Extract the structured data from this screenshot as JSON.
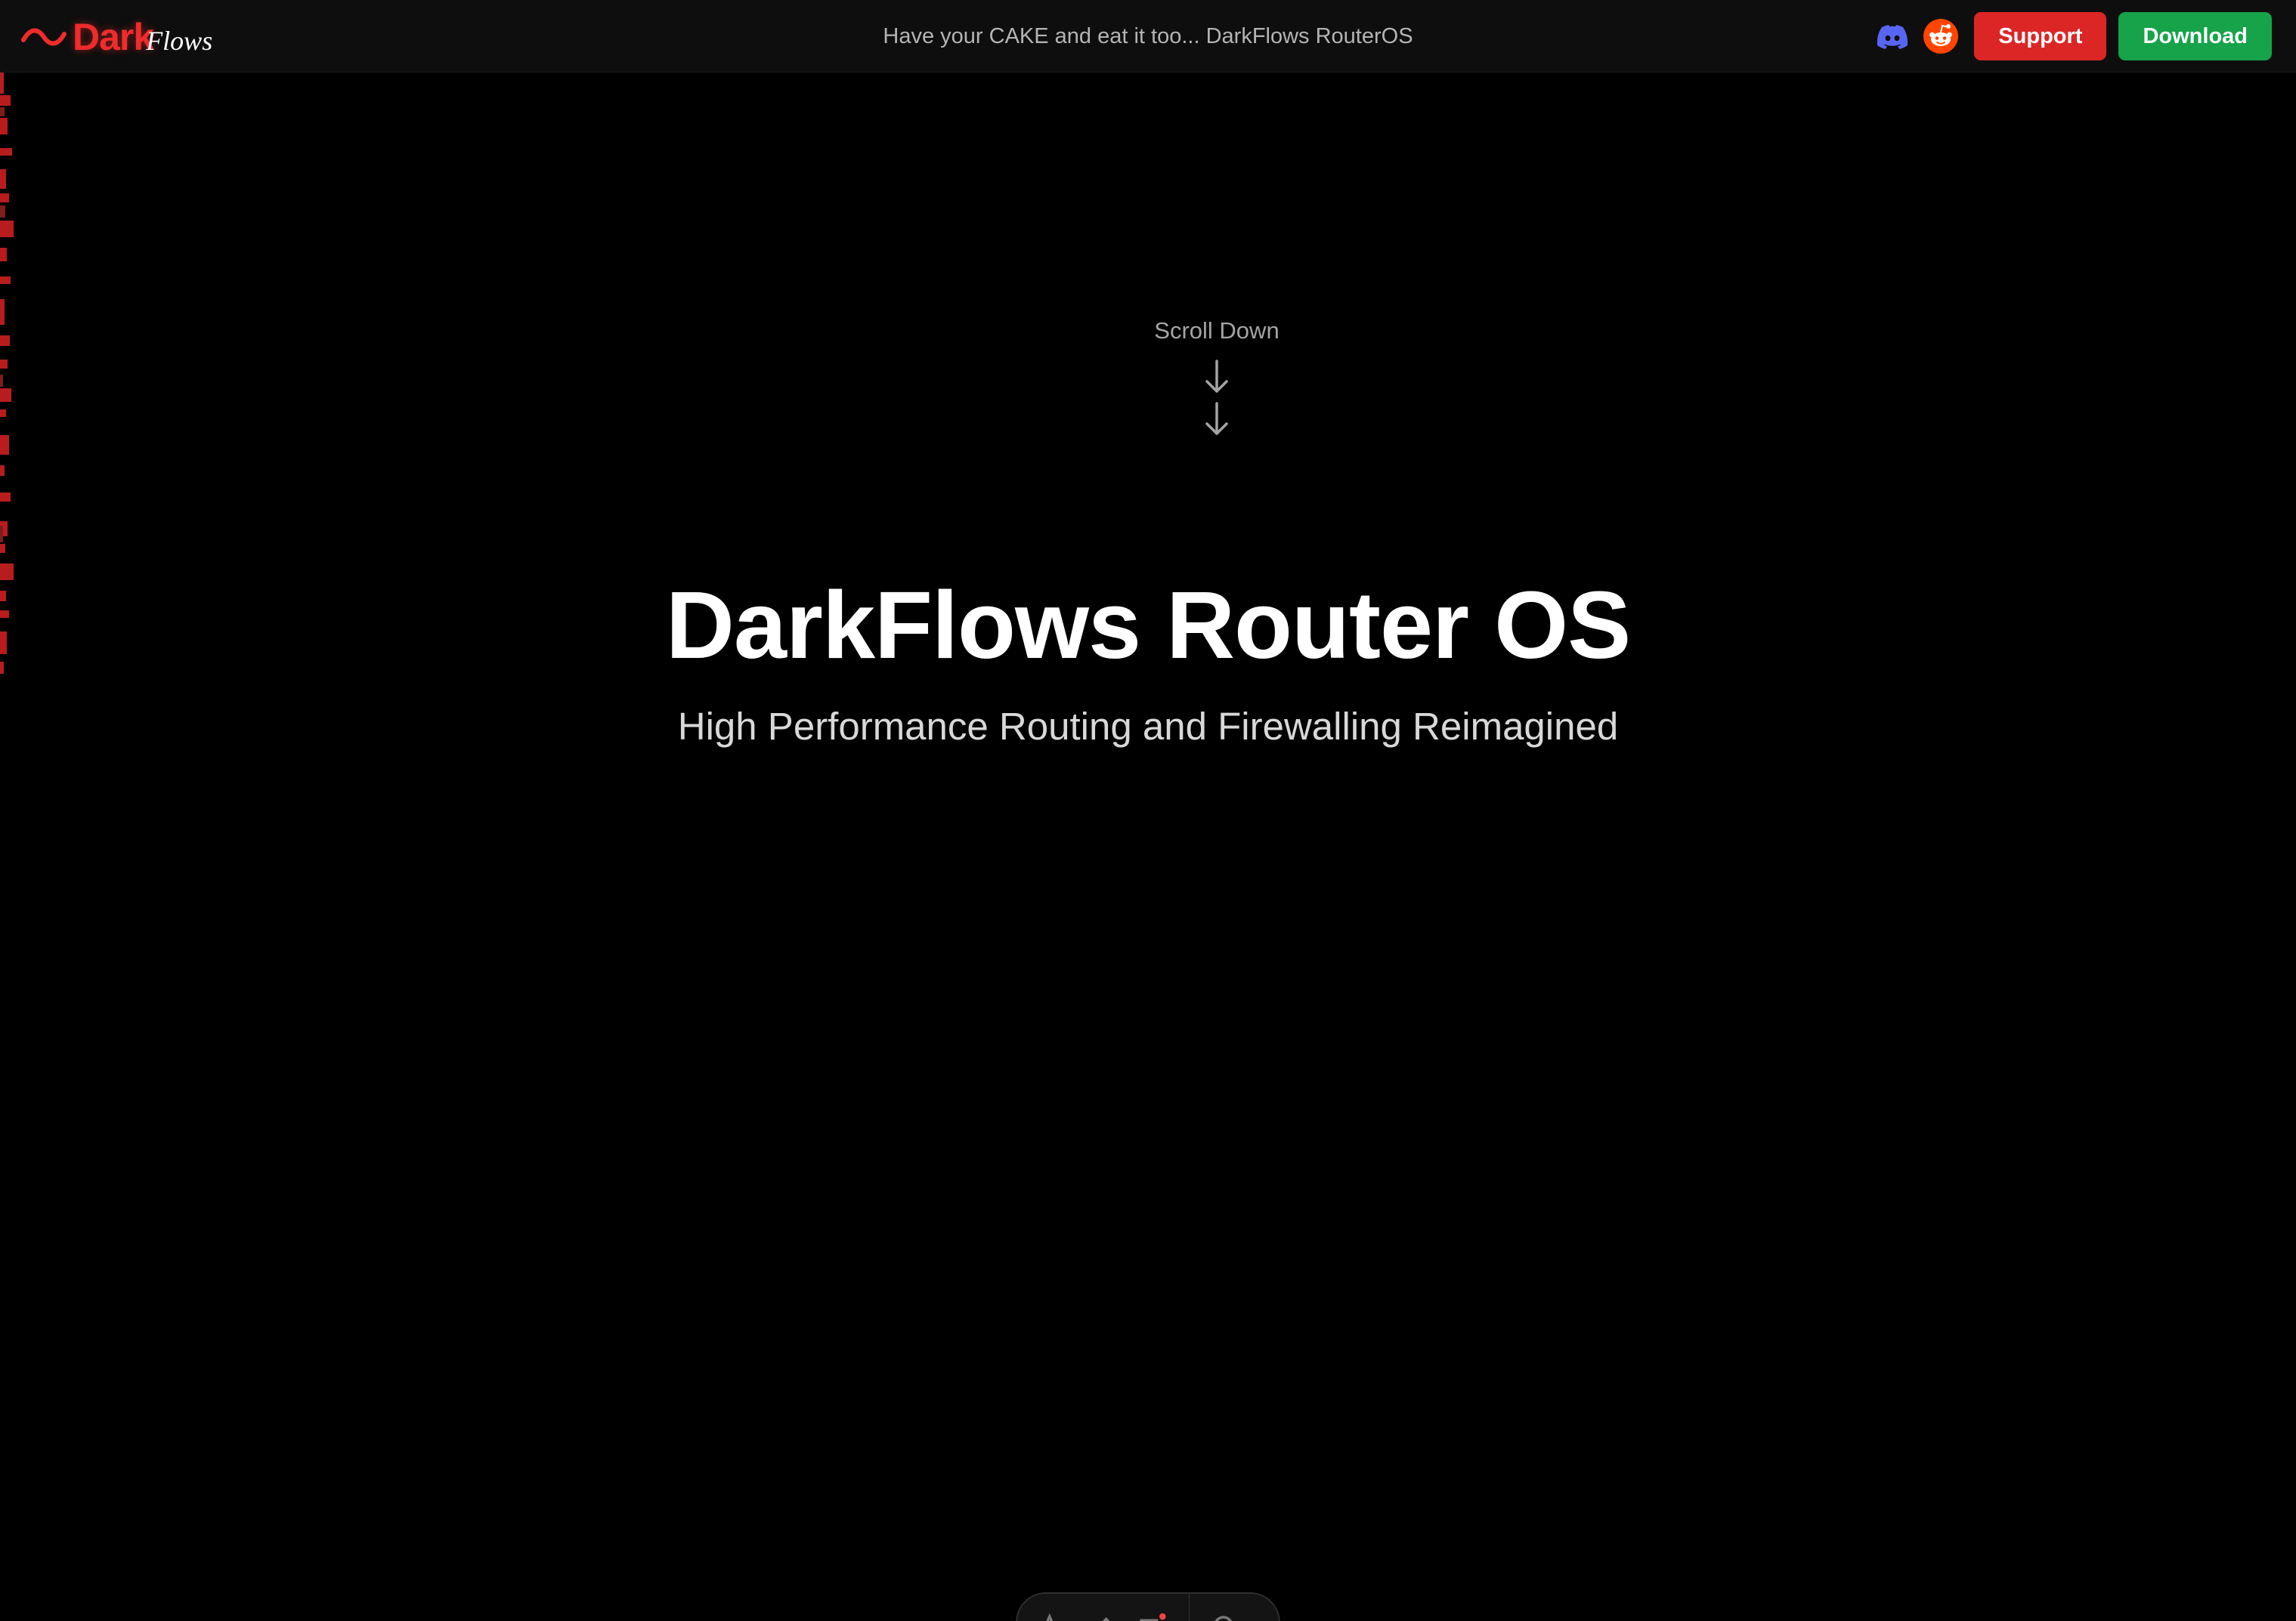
{
  "brand": {
    "name_part1": "Dark",
    "name_part2": "Flows",
    "accent": "#ef2b2b"
  },
  "header": {
    "tagline": "Have your CAKE and eat it too... DarkFlows RouterOS",
    "icons": [
      "discord-icon",
      "reddit-icon"
    ],
    "support_label": "Support",
    "download_label": "Download",
    "support_color": "#dc2626",
    "download_color": "#16a34a"
  },
  "hero": {
    "scroll_label": "Scroll Down",
    "title": "DarkFlows Router OS",
    "subtitle": "High Performance Routing and Firewalling Reimagined"
  },
  "toolbar": {
    "icons": [
      "text-tool-icon",
      "draw-tool-icon",
      "list-tool-icon",
      "settings-icon"
    ]
  }
}
